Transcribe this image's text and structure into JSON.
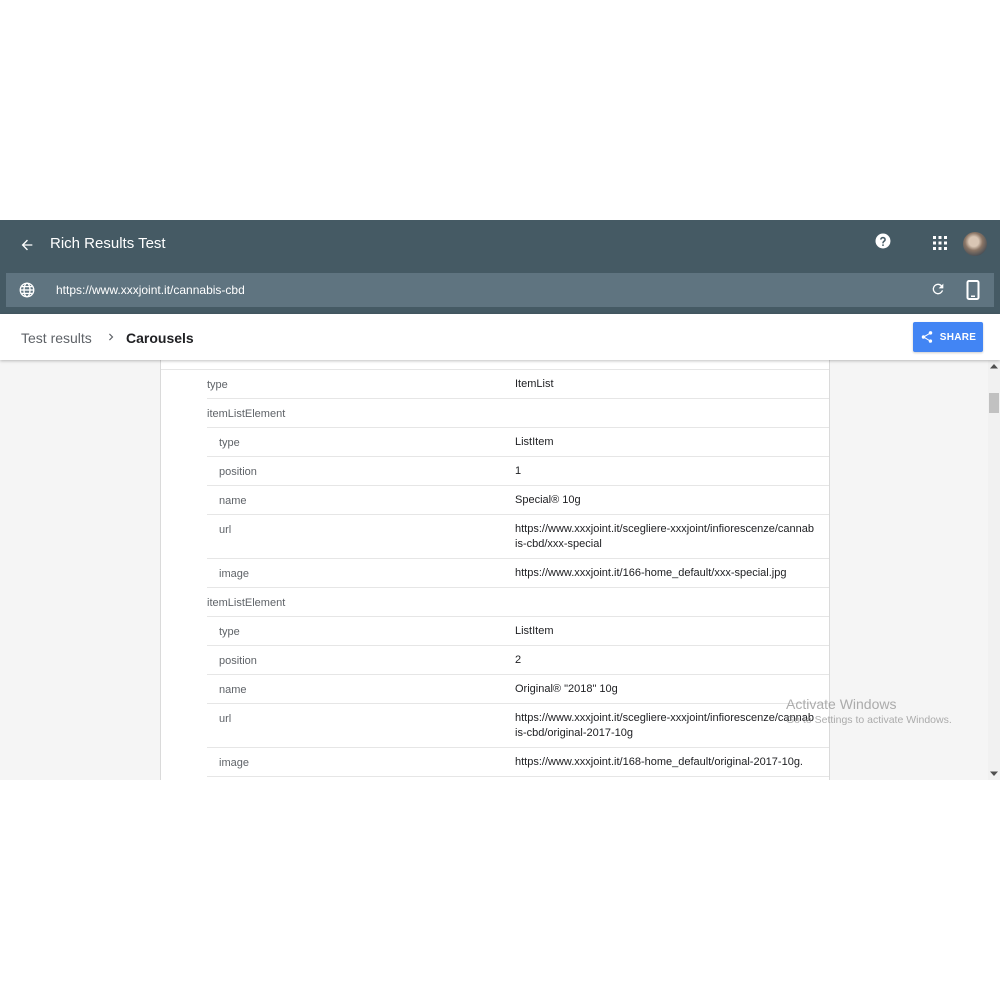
{
  "header": {
    "title": "Rich Results Test",
    "icons": [
      "back-arrow-icon",
      "help-icon",
      "apps-grid-icon",
      "avatar"
    ]
  },
  "urlbar": {
    "url": "https://www.xxxjoint.it/cannabis-cbd",
    "icons": [
      "globe-icon",
      "reload-icon",
      "mobile-device-icon"
    ]
  },
  "breadcrumb": {
    "parent": "Test results",
    "current": "Carousels"
  },
  "share": {
    "label": "SHARE"
  },
  "rows": [
    {
      "key": "type",
      "value": "ItemList",
      "indent": false
    },
    {
      "key": "itemListElement",
      "value": "",
      "indent": false
    },
    {
      "key": "type",
      "value": "ListItem",
      "indent": true
    },
    {
      "key": "position",
      "value": "1",
      "indent": true
    },
    {
      "key": "name",
      "value": "Special® 10g",
      "indent": true
    },
    {
      "key": "url",
      "value": "https://www.xxxjoint.it/scegliere-xxxjoint/infiorescenze/cannabis-cbd/xxx-special",
      "indent": true
    },
    {
      "key": "image",
      "value": "https://www.xxxjoint.it/166-home_default/xxx-special.jpg",
      "indent": true
    },
    {
      "key": "itemListElement",
      "value": "",
      "indent": false
    },
    {
      "key": "type",
      "value": "ListItem",
      "indent": true
    },
    {
      "key": "position",
      "value": "2",
      "indent": true
    },
    {
      "key": "name",
      "value": "Original® \"2018\" 10g",
      "indent": true
    },
    {
      "key": "url",
      "value": "https://www.xxxjoint.it/scegliere-xxxjoint/infiorescenze/cannabis-cbd/original-2017-10g",
      "indent": true
    },
    {
      "key": "image",
      "value": "https://www.xxxjoint.it/168-home_default/original-2017-10g.",
      "indent": true
    }
  ],
  "watermark": {
    "line1": "Activate Windows",
    "line2": "Go to Settings to activate Windows."
  },
  "colors": {
    "header_bg": "#455a64",
    "urlbar_bg": "#5f7480",
    "share_button": "#4285f4"
  }
}
